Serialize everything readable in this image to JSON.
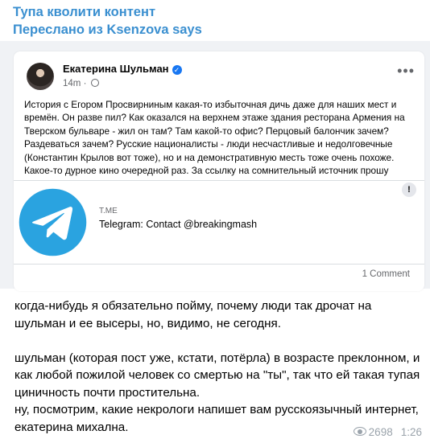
{
  "header": {
    "channel": "Тупа кволити контент",
    "forwarded": "Переслано из Ksenzova says"
  },
  "post": {
    "author": "Екатерина Шульман",
    "time": "14m",
    "more_icon": "•••",
    "text": "История с Егором Просвирниным какая-то избыточная дичь даже для наших мест и времён. Он разве пил? Как оказался на верхнем этаже здания ресторана Армения на Тверском бульваре - жил он там? Там какой-то офис? Перцовый балончик зачем? Раздеваться зачем? Русские националисты - люди несчастливые и недолговечные (Константин Крылов вот тоже), но и на демонстративную месть тоже очень похоже. Какое-то дурное кино очередной раз. За ссылку на сомнительный источник прошу прощения, но это хоть какое-то свидетельство.",
    "link": {
      "domain": "T.ME",
      "title": "Telegram: Contact @breakingmash",
      "more": "!"
    },
    "comments": "1 Comment"
  },
  "message": {
    "p1": "когда-нибудь я обязательно пойму, почему люди так дрочат на шульман и ее высеры, но, видимо, не сегодня.",
    "p2": "шульман (которая пост уже, кстати, потёрла) в возрасте преклонном, и как любой пожилой человек со смертью на \"ты\", так что ей такая тупая циничность почти простительна.",
    "p3": "ну, посмотрим, какие некрологи напишет вам русскоязычный интернет, екатерина михална."
  },
  "footer": {
    "views": "2698",
    "time": "1:26"
  },
  "colors": {
    "header": "#3a8fd0",
    "telegram": "#2aa3e0",
    "verified": "#1877f2"
  }
}
